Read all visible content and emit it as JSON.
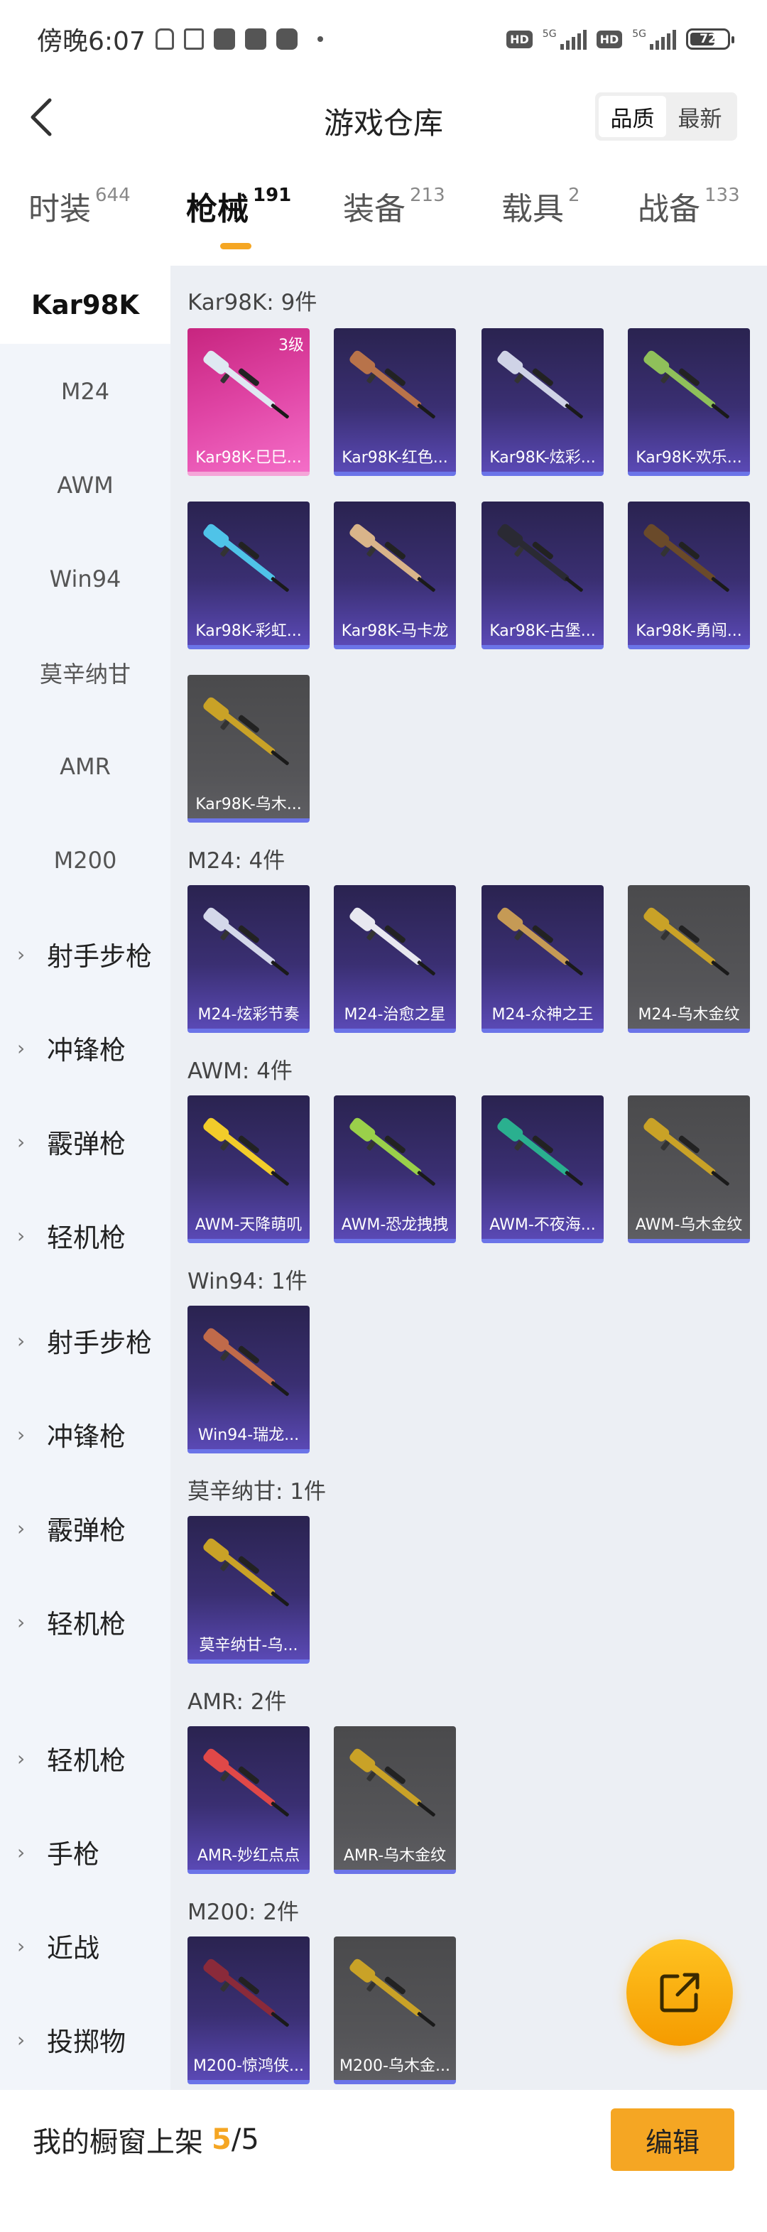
{
  "status_bar": {
    "time": "傍晚6:07",
    "battery": "72",
    "net1": "5G",
    "net2": "5G",
    "hd": "HD"
  },
  "header": {
    "title": "游戏仓库",
    "sort_options": [
      "品质",
      "最新"
    ],
    "active_sort": 0
  },
  "tabs": [
    {
      "label": "时装",
      "count": "644"
    },
    {
      "label": "枪械",
      "count": "191"
    },
    {
      "label": "装备",
      "count": "213"
    },
    {
      "label": "载具",
      "count": "2"
    },
    {
      "label": "战备",
      "count": "133"
    }
  ],
  "active_tab": 1,
  "sidebar": {
    "items": [
      "Kar98K",
      "M24",
      "AWM",
      "Win94",
      "莫辛纳甘",
      "AMR",
      "M200"
    ],
    "groups": [
      "射手步枪",
      "冲锋枪",
      "霰弹枪",
      "轻机枪",
      "射手步枪",
      "冲锋枪",
      "霰弹枪",
      "轻机枪",
      "轻机枪",
      "手枪",
      "近战",
      "投掷物"
    ]
  },
  "sections": [
    {
      "title": "Kar98K: 9件",
      "items": [
        {
          "label": "Kar98K-巳巳...",
          "level": "3级",
          "style": "pink",
          "color": "#dfe8f2"
        },
        {
          "label": "Kar98K-红色...",
          "style": "purple",
          "color": "#b8734a"
        },
        {
          "label": "Kar98K-炫彩...",
          "style": "purple",
          "color": "#cfd3e6"
        },
        {
          "label": "Kar98K-欢乐...",
          "style": "purple",
          "color": "#8fc05a"
        },
        {
          "label": "Kar98K-彩虹...",
          "style": "purple",
          "color": "#4fc3e8"
        },
        {
          "label": "Kar98K-马卡龙",
          "style": "purple",
          "color": "#d9b48a"
        },
        {
          "label": "Kar98K-古堡...",
          "style": "purple",
          "color": "#2a2a33"
        },
        {
          "label": "Kar98K-勇闯...",
          "style": "purple",
          "color": "#6a4a2a"
        },
        {
          "label": "Kar98K-乌木...",
          "style": "grey",
          "color": "#c9a227"
        }
      ]
    },
    {
      "title": "M24: 4件",
      "items": [
        {
          "label": "M24-炫彩节奏",
          "style": "purple",
          "color": "#d4d8ea"
        },
        {
          "label": "M24-治愈之星",
          "style": "purple",
          "color": "#e8e8f0"
        },
        {
          "label": "M24-众神之王",
          "style": "purple",
          "color": "#c59a55"
        },
        {
          "label": "M24-乌木金纹",
          "style": "grey",
          "color": "#c9a227"
        }
      ]
    },
    {
      "title": "AWM: 4件",
      "items": [
        {
          "label": "AWM-天降萌叽",
          "style": "purple",
          "color": "#f2cc2a"
        },
        {
          "label": "AWM-恐龙拽拽",
          "style": "purple",
          "color": "#9ad04a"
        },
        {
          "label": "AWM-不夜海...",
          "style": "purple",
          "color": "#2ab08f"
        },
        {
          "label": "AWM-乌木金纹",
          "style": "grey",
          "color": "#c9a227"
        }
      ]
    },
    {
      "title": "Win94: 1件",
      "items": [
        {
          "label": "Win94-瑞龙...",
          "style": "purple",
          "color": "#c06a4a"
        }
      ]
    },
    {
      "title": "莫辛纳甘: 1件",
      "items": [
        {
          "label": "莫辛纳甘-乌...",
          "style": "purple",
          "color": "#c9a227"
        }
      ]
    },
    {
      "title": "AMR: 2件",
      "items": [
        {
          "label": "AMR-妙红点点",
          "style": "purple",
          "color": "#e04848"
        },
        {
          "label": "AMR-乌木金纹",
          "style": "grey",
          "color": "#c9a227"
        }
      ]
    },
    {
      "title": "M200: 2件",
      "items": [
        {
          "label": "M200-惊鸿侠...",
          "style": "purple",
          "color": "#8a2a3a"
        },
        {
          "label": "M200-乌木金...",
          "style": "grey",
          "color": "#c9a227"
        }
      ]
    }
  ],
  "bottom": {
    "text": "我的橱窗上架",
    "current": "5",
    "separator": "/",
    "total": "5",
    "edit_label": "编辑"
  },
  "accent": "#f5a623"
}
